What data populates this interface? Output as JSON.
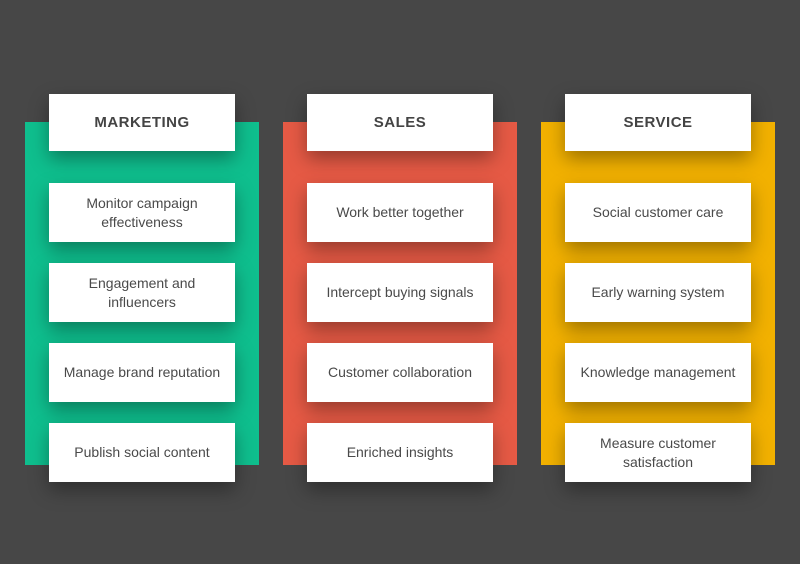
{
  "columns": [
    {
      "title": "MARKETING",
      "color": "#0fbf8e",
      "items": [
        "Monitor campaign effectiveness",
        "Engagement and influencers",
        "Manage brand reputation",
        "Publish social content"
      ]
    },
    {
      "title": "SALES",
      "color": "#e65a45",
      "items": [
        "Work better together",
        "Intercept buying signals",
        "Customer collaboration",
        "Enriched insights"
      ]
    },
    {
      "title": "SERVICE",
      "color": "#f2b100",
      "items": [
        "Social customer care",
        "Early warning system",
        "Knowledge management",
        "Measure customer satisfaction"
      ]
    }
  ]
}
